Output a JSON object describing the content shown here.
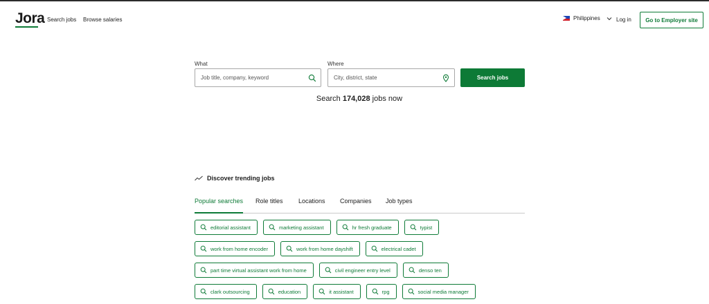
{
  "header": {
    "logo": "Jora",
    "nav": [
      "Search jobs",
      "Browse salaries"
    ],
    "country": "Philippines",
    "login": "Log in",
    "employer_button": "Go to Employer site"
  },
  "search": {
    "what_label": "What",
    "what_placeholder": "Job title, company, keyword",
    "where_label": "Where",
    "where_placeholder": "City, district, state",
    "button": "Search jobs",
    "count_prefix": "Search ",
    "count": "174,028",
    "count_suffix": " jobs now"
  },
  "trending": {
    "title": "Discover trending jobs",
    "tabs": [
      "Popular searches",
      "Role titles",
      "Locations",
      "Companies",
      "Job types"
    ],
    "active_tab": 0,
    "chips": [
      [
        "editorial assistant",
        "marketing assistant",
        "hr fresh graduate",
        "typist"
      ],
      [
        "work from home encoder",
        "work from home dayshift",
        "electrical cadet"
      ],
      [
        "part time virtual assistant work from home",
        "civil engineer entry level",
        "denso ten"
      ],
      [
        "clark outsourcing",
        "education",
        "it assistant",
        "rpg",
        "social media manager"
      ]
    ]
  },
  "colors": {
    "brand": "#0d7a36",
    "text": "#1c1c1c",
    "border": "#a8a8a8"
  },
  "icons": [
    "search-icon",
    "location-pin-icon",
    "chevron-down-icon",
    "trending-icon",
    "flag-icon"
  ]
}
